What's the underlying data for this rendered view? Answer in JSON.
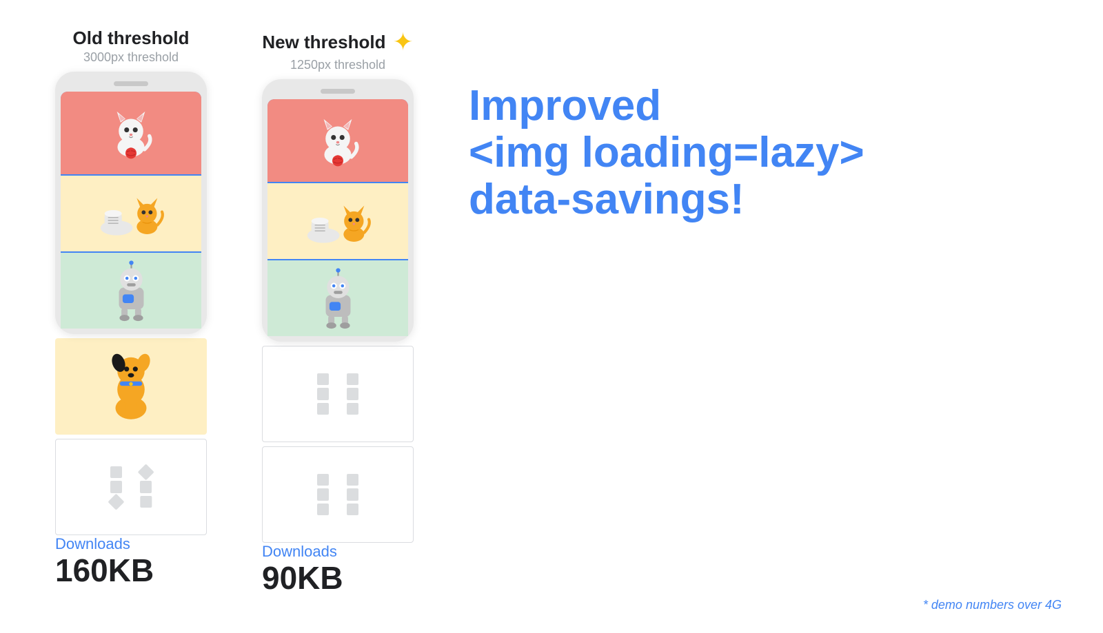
{
  "left_column": {
    "threshold_title": "Old threshold",
    "threshold_subtitle": "3000px threshold",
    "downloads_label": "Downloads",
    "downloads_value": "160KB"
  },
  "right_column": {
    "threshold_title": "New threshold",
    "threshold_subtitle": "1250px threshold",
    "downloads_label": "Downloads",
    "downloads_value": "90KB",
    "sparkle": "✦"
  },
  "headline": {
    "line1": "Improved",
    "line2": "<img loading=lazy>",
    "line3": "data-savings!"
  },
  "demo_note": "* demo numbers over 4G",
  "colors": {
    "blue": "#4285f4",
    "text_dark": "#202124",
    "text_gray": "#9aa0a6",
    "yellow": "#f9c513"
  }
}
